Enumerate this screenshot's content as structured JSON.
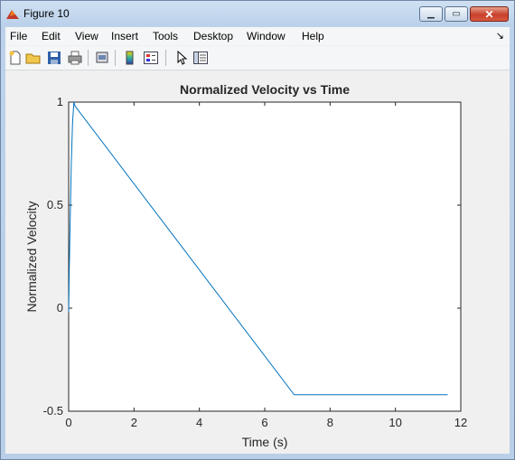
{
  "window": {
    "title": "Figure 10"
  },
  "menu": [
    "File",
    "Edit",
    "View",
    "Insert",
    "Tools",
    "Desktop",
    "Window",
    "Help"
  ],
  "toolbar_icons": [
    "new-figure-icon",
    "open-file-icon",
    "save-icon",
    "print-icon",
    "print-preview-icon",
    "colorbar-icon",
    "legend-icon",
    "pointer-icon",
    "property-editor-icon"
  ],
  "chart_data": {
    "type": "line",
    "title": "Normalized Velocity vs Time",
    "xlabel": "Time (s)",
    "ylabel": "Normalized Velocity",
    "xlim": [
      0,
      12
    ],
    "ylim": [
      -0.5,
      1
    ],
    "xticks": [
      0,
      2,
      4,
      6,
      8,
      10,
      12
    ],
    "yticks": [
      -0.5,
      0,
      0.5,
      1
    ],
    "ytick_labels": [
      "-0.5",
      "0",
      "0.5",
      "1"
    ],
    "grid": false,
    "series": [
      {
        "color": "#0072bd",
        "x": [
          0,
          0.02,
          0.05,
          0.08,
          0.12,
          0.16,
          0.2,
          6.9,
          11.6
        ],
        "y": [
          -0.02,
          0.2,
          0.45,
          0.7,
          0.9,
          1.0,
          0.98,
          -0.42,
          -0.42
        ]
      }
    ]
  }
}
